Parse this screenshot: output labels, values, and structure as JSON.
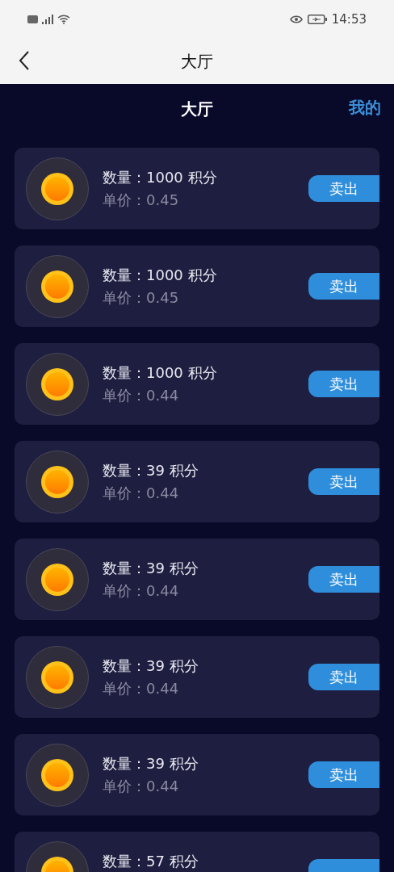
{
  "status_bar": {
    "time": "14:53"
  },
  "nav_bar": {
    "title": "大厅"
  },
  "header": {
    "title": "大厅",
    "link": "我的"
  },
  "listings": [
    {
      "quantity": "数量：1000 积分",
      "price": "单价：0.45",
      "action": "卖出"
    },
    {
      "quantity": "数量：1000 积分",
      "price": "单价：0.45",
      "action": "卖出"
    },
    {
      "quantity": "数量：1000 积分",
      "price": "单价：0.44",
      "action": "卖出"
    },
    {
      "quantity": "数量：39 积分",
      "price": "单价：0.44",
      "action": "卖出"
    },
    {
      "quantity": "数量：39 积分",
      "price": "单价：0.44",
      "action": "卖出"
    },
    {
      "quantity": "数量：39 积分",
      "price": "单价：0.44",
      "action": "卖出"
    },
    {
      "quantity": "数量：39 积分",
      "price": "单价：0.44",
      "action": "卖出"
    },
    {
      "quantity": "数量：57 积分"
    }
  ]
}
